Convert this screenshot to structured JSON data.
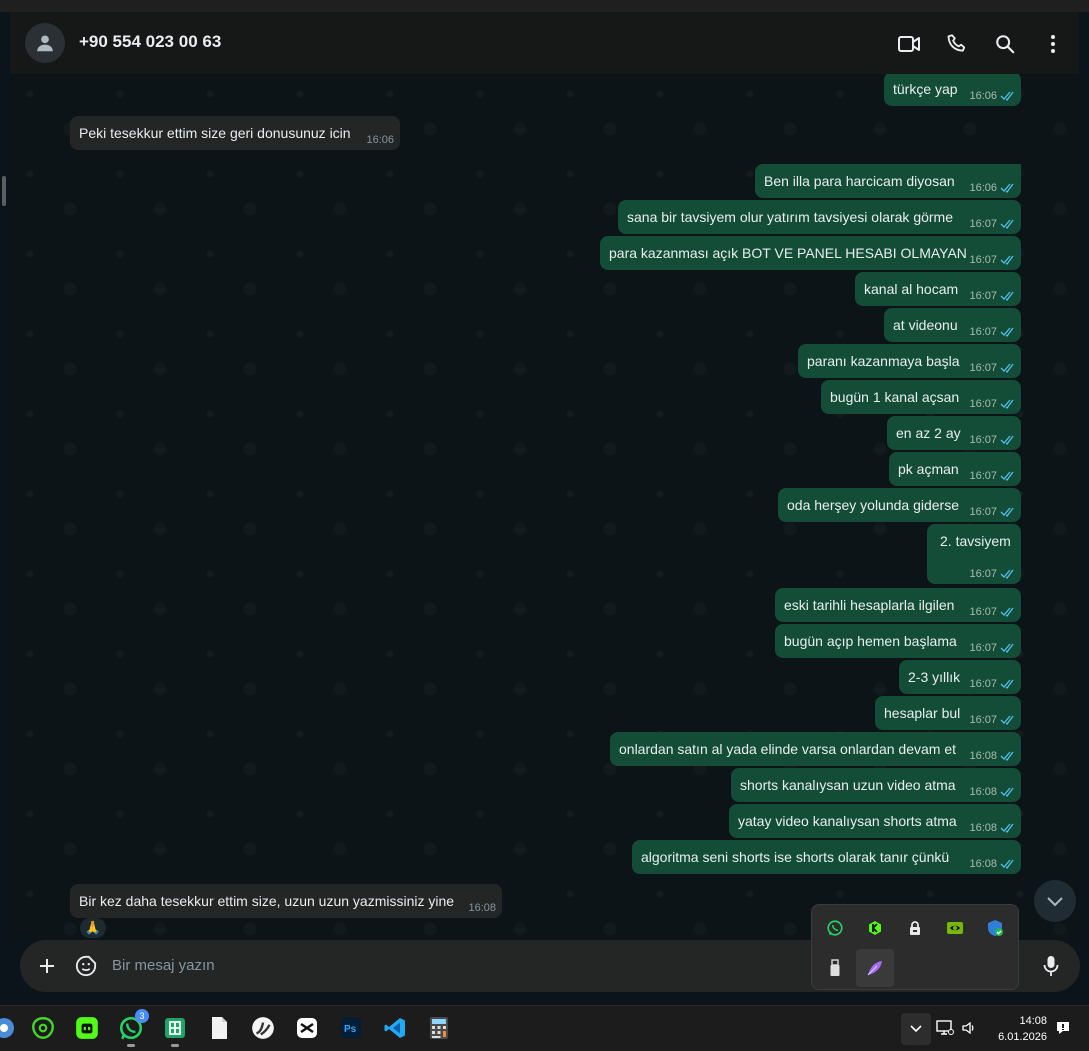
{
  "header": {
    "contact": "+90 554 023 00 63"
  },
  "messages": [
    {
      "dir": "out",
      "text": "türkçe yap",
      "time": "16:06"
    },
    {
      "dir": "in",
      "text": "Peki tesekkur ettim size geri donusunuz icin",
      "time": "16:06"
    },
    {
      "dir": "out",
      "text": "Ben illa para harcicam diyosan",
      "time": "16:06"
    },
    {
      "dir": "out",
      "text": "sana bir tavsiyem olur yatırım tavsiyesi olarak görme",
      "time": "16:07"
    },
    {
      "dir": "out",
      "text": "para kazanması açık BOT VE PANEL HESABI OLMAYAN",
      "time": "16:07"
    },
    {
      "dir": "out",
      "text": "kanal al hocam",
      "time": "16:07"
    },
    {
      "dir": "out",
      "text": "at videonu",
      "time": "16:07"
    },
    {
      "dir": "out",
      "text": "paranı kazanmaya başla",
      "time": "16:07"
    },
    {
      "dir": "out",
      "text": "bugün 1 kanal açsan",
      "time": "16:07"
    },
    {
      "dir": "out",
      "text": "en az 2 ay",
      "time": "16:07"
    },
    {
      "dir": "out",
      "text": "pk açman",
      "time": "16:07"
    },
    {
      "dir": "out",
      "text": "oda herşey yolunda giderse",
      "time": "16:07"
    },
    {
      "dir": "out",
      "text": "2.  tavsiyem",
      "time": "16:07"
    },
    {
      "dir": "out",
      "text": "eski tarihli hesaplarla ilgilen",
      "time": "16:07"
    },
    {
      "dir": "out",
      "text": "bugün açıp hemen başlama",
      "time": "16:07"
    },
    {
      "dir": "out",
      "text": "2-3 yıllık",
      "time": "16:07"
    },
    {
      "dir": "out",
      "text": "hesaplar bul",
      "time": "16:07"
    },
    {
      "dir": "out",
      "text": "onlardan satın al yada elinde varsa onlardan devam et",
      "time": "16:08"
    },
    {
      "dir": "out",
      "text": "shorts kanalıysan uzun video atma",
      "time": "16:08"
    },
    {
      "dir": "out",
      "text": "yatay video kanalıysan shorts atma",
      "time": "16:08"
    },
    {
      "dir": "out",
      "text": "algoritma seni shorts ise shorts olarak tanır çünkü",
      "time": "16:08"
    },
    {
      "dir": "in",
      "text": "Bir kez daha tesekkur ettim size, uzun uzun yazmissiniz yine",
      "time": "16:08"
    }
  ],
  "reaction": "🙏",
  "composer": {
    "placeholder": "Bir mesaj yazın"
  },
  "taskbar": {
    "whatsapp_badge": "3",
    "time": "14:08",
    "date": "6.01.2026"
  },
  "colors": {
    "outgoing": "#144d37",
    "incoming": "#242626",
    "ticks": "#53bdeb"
  }
}
